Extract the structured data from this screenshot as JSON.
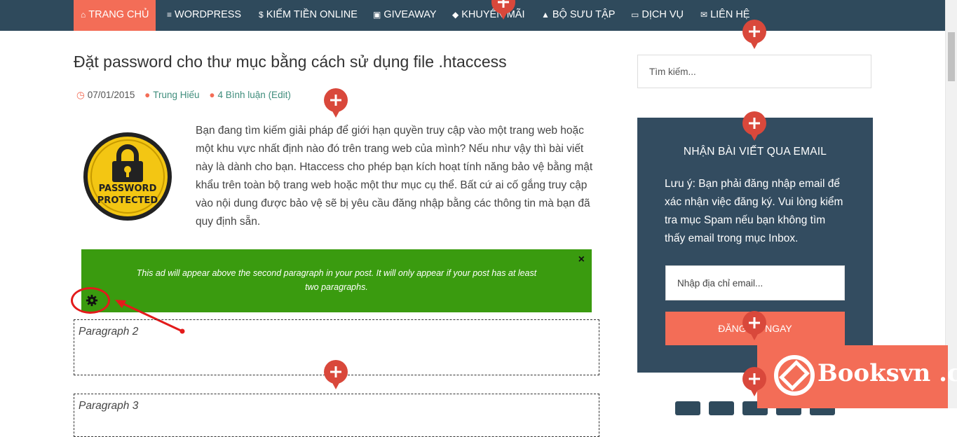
{
  "nav": {
    "items": [
      {
        "icon": "home-icon",
        "glyph": "⌂",
        "label": "TRANG CHỦ",
        "active": true
      },
      {
        "icon": "list-icon",
        "glyph": "≡",
        "label": "WORDPRESS"
      },
      {
        "icon": "dollar-icon",
        "glyph": "$",
        "label": "KIẾM TIỀN ONLINE"
      },
      {
        "icon": "gift-icon",
        "glyph": "▣",
        "label": "GIVEAWAY"
      },
      {
        "icon": "tag-icon",
        "glyph": "◆",
        "label": "KHUYẾN MÃI"
      },
      {
        "icon": "thumbs-up-icon",
        "glyph": "▲",
        "label": "BỘ SƯU TẬP"
      },
      {
        "icon": "laptop-icon",
        "glyph": "▭",
        "label": "DỊCH VỤ"
      },
      {
        "icon": "envelope-icon",
        "glyph": "✉",
        "label": "LIÊN HỆ"
      }
    ]
  },
  "article": {
    "title": "Đặt password cho thư mục bằng cách sử dụng file .htaccess",
    "date": "07/01/2015",
    "author": "Trung Hiếu",
    "comments": "4 Bình luận",
    "edit": "(Edit)",
    "intro": "Bạn đang tìm kiếm giải pháp để giới hạn quyền truy cập vào một trang web hoặc một khu vực nhất định nào đó trên trang web của mình? Nếu như vậy thì bài viết này là dành cho bạn. Htaccess cho phép bạn kích hoạt tính năng bảo vệ bằng mật khẩu trên toàn bộ trang web hoặc một thư mục cụ thể. Bất cứ ai cố gắng truy cập vào nội dung được bảo vệ sẽ bị yêu cầu đăng nhập bằng các thông tin mà bạn đã quy định sẵn.",
    "thumb_text_1": "PASSWORD",
    "thumb_text_2": "PROTECTED",
    "ad_text": "This ad will appear above the second paragraph in your post. It will only appear if your post has at least two paragraphs.",
    "ad_close": "×",
    "paragraph2": "Paragraph 2",
    "paragraph3": "Paragraph 3"
  },
  "sidebar": {
    "search_placeholder": "Tìm kiếm...",
    "email_title": "NHẬN BÀI VIẾT QUA EMAIL",
    "email_note": "Lưu ý: Bạn phải đăng nhập email để xác nhận việc đăng ký. Vui lòng kiểm tra mục Spam nếu bạn không tìm thấy email trong mục Inbox.",
    "email_placeholder": "Nhập địa chỉ email...",
    "email_button": "ĐĂNG KÝ NGAY"
  },
  "watermark": {
    "text": "Booksvn .com"
  },
  "colors": {
    "nav": "#2f4a5c",
    "accent": "#f36d57",
    "ad": "#3a9b0f",
    "pin": "#d9483b"
  }
}
